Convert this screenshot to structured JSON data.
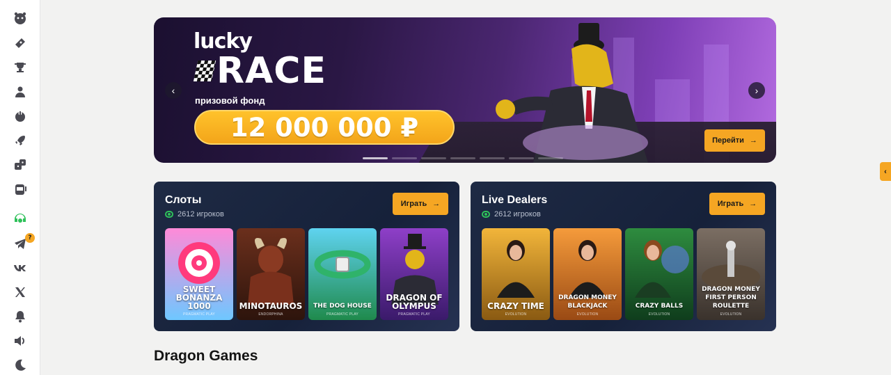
{
  "sidebar": {
    "items": [
      {
        "icon": "logo-face-icon"
      },
      {
        "icon": "ticket-icon"
      },
      {
        "icon": "trophy-icon"
      },
      {
        "icon": "dealer-icon"
      },
      {
        "icon": "joystick-icon"
      },
      {
        "icon": "rocket-icon"
      },
      {
        "icon": "dice-icon"
      },
      {
        "icon": "slot-machine-icon"
      },
      {
        "icon": "support-icon"
      },
      {
        "icon": "telegram-icon",
        "badge": "?"
      },
      {
        "icon": "vk-icon"
      },
      {
        "icon": "x-icon"
      },
      {
        "icon": "bell-icon"
      },
      {
        "icon": "sound-icon"
      },
      {
        "icon": "moon-icon"
      }
    ]
  },
  "banner": {
    "brand_top": "lucky",
    "brand_main": "RACE",
    "fund_label": "призовой фонд",
    "prize": "12 000 000 ₽",
    "cta_label": "Перейти",
    "prev_icon": "‹",
    "next_icon": "›",
    "slides": 7,
    "active_slide": 0
  },
  "panels": [
    {
      "title": "Слоты",
      "players": "2612 игроков",
      "play_label": "Играть",
      "cards": [
        {
          "name": "SWEET BONANZA 1000",
          "provider": "PRAGMATIC PLAY",
          "colors": [
            "#ff8ad8",
            "#6ec7ff"
          ]
        },
        {
          "name": "MINOTAUROS",
          "provider": "ENDORPHINA",
          "colors": [
            "#6b2f1c",
            "#2d140c"
          ]
        },
        {
          "name": "THE DOG HOUSE",
          "provider": "PRAGMATIC PLAY",
          "colors": [
            "#5fd3f0",
            "#1f8a4c"
          ]
        },
        {
          "name": "DRAGON OF OLYMPUS",
          "provider": "PRAGMATIC PLAY",
          "colors": [
            "#8e3fc8",
            "#3a1a6a"
          ]
        }
      ]
    },
    {
      "title": "Live Dealers",
      "players": "2612 игроков",
      "play_label": "Играть",
      "cards": [
        {
          "name": "CRAZY TIME",
          "provider": "EVOLUTION",
          "colors": [
            "#f2b53a",
            "#8a5a12"
          ]
        },
        {
          "name": "DRAGON MONEY BLACKJACK",
          "provider": "EVOLUTION",
          "colors": [
            "#f59b3b",
            "#9a4a14"
          ]
        },
        {
          "name": "CRAZY BALLS",
          "provider": "EVOLUTION",
          "colors": [
            "#2e8c3f",
            "#0f3d1c"
          ]
        },
        {
          "name": "DRAGON MONEY FIRST PERSON ROULETTE",
          "provider": "EVOLUTION",
          "colors": [
            "#7b6e63",
            "#3a322c"
          ]
        }
      ]
    }
  ],
  "section_title": "Dragon Games",
  "side_tab_icon": "‹",
  "colors": {
    "accent": "#f5a623",
    "live": "#2fc15a"
  }
}
